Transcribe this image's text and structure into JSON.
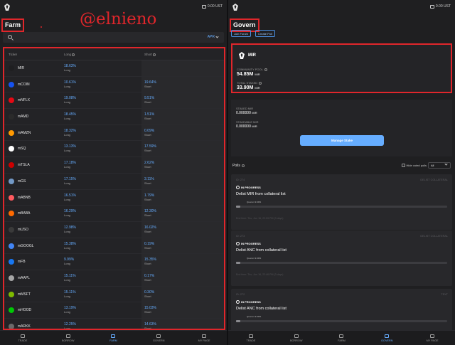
{
  "wallet": {
    "balance": "0.00 UST"
  },
  "watermark": "@elnieno",
  "farm": {
    "title": "Farm",
    "sort_select": "APR",
    "columns": {
      "ticker": "Ticker",
      "long": "Long",
      "short": "Short"
    },
    "rows": [
      {
        "ticker": "MIR",
        "long_apr": "18.63%",
        "long_action": "Long",
        "short_apr": "",
        "short_action": "",
        "icon_color": "#1f1f21",
        "icon": "mir-icon"
      },
      {
        "ticker": "mCOIN",
        "long_apr": "10.61%",
        "long_action": "Long",
        "short_apr": "19.64%",
        "short_action": "Short",
        "icon_color": "#1652f0",
        "icon": "coinbase-icon"
      },
      {
        "ticker": "mNFLX",
        "long_apr": "19.08%",
        "long_action": "Long",
        "short_apr": "9.51%",
        "short_action": "Short",
        "icon_color": "#e50914",
        "icon": "netflix-icon"
      },
      {
        "ticker": "mAMD",
        "long_apr": "18.45%",
        "long_action": "Long",
        "short_apr": "1.51%",
        "short_action": "Short",
        "icon_color": "#2a2a2a",
        "icon": "amd-icon"
      },
      {
        "ticker": "mAMZN",
        "long_apr": "18.32%",
        "long_action": "Long",
        "short_apr": "0.09%",
        "short_action": "Short",
        "icon_color": "#ff9900",
        "icon": "amazon-icon"
      },
      {
        "ticker": "mSQ",
        "long_apr": "13.13%",
        "long_action": "Long",
        "short_apr": "17.59%",
        "short_action": "Short",
        "icon_color": "#ffffff",
        "icon": "square-icon"
      },
      {
        "ticker": "mTSLA",
        "long_apr": "17.18%",
        "long_action": "Long",
        "short_apr": "2.62%",
        "short_action": "Short",
        "icon_color": "#cc0000",
        "icon": "tesla-icon"
      },
      {
        "ticker": "mGS",
        "long_apr": "17.15%",
        "long_action": "Long",
        "short_apr": "3.11%",
        "short_action": "Short",
        "icon_color": "#7399c6",
        "icon": "goldman-icon"
      },
      {
        "ticker": "mABNB",
        "long_apr": "16.51%",
        "long_action": "Long",
        "short_apr": "1.79%",
        "short_action": "Short",
        "icon_color": "#ff5a5f",
        "icon": "airbnb-icon"
      },
      {
        "ticker": "mBABA",
        "long_apr": "16.29%",
        "long_action": "Long",
        "short_apr": "12.30%",
        "short_action": "Short",
        "icon_color": "#ff6a00",
        "icon": "alibaba-icon"
      },
      {
        "ticker": "mUSO",
        "long_apr": "12.98%",
        "long_action": "Long",
        "short_apr": "16.02%",
        "short_action": "Short",
        "icon_color": "#3a3a3a",
        "icon": "uso-icon"
      },
      {
        "ticker": "mGOOGL",
        "long_apr": "15.38%",
        "long_action": "Long",
        "short_apr": "0.19%",
        "short_action": "Short",
        "icon_color": "#4285f4",
        "icon": "google-icon"
      },
      {
        "ticker": "mFB",
        "long_apr": "9.99%",
        "long_action": "Long",
        "short_apr": "15.35%",
        "short_action": "Short",
        "icon_color": "#1877f2",
        "icon": "facebook-icon"
      },
      {
        "ticker": "mAAPL",
        "long_apr": "15.11%",
        "long_action": "Long",
        "short_apr": "0.17%",
        "short_action": "Short",
        "icon_color": "#a6a6a6",
        "icon": "apple-icon"
      },
      {
        "ticker": "mMSFT",
        "long_apr": "15.11%",
        "long_action": "Long",
        "short_apr": "0.30%",
        "short_action": "Short",
        "icon_color": "#7fba00",
        "icon": "microsoft-icon"
      },
      {
        "ticker": "mHOOD",
        "long_apr": "13.19%",
        "long_action": "Long",
        "short_apr": "15.03%",
        "short_action": "Short",
        "icon_color": "#00c805",
        "icon": "robinhood-icon"
      },
      {
        "ticker": "mARKK",
        "long_apr": "12.25%",
        "long_action": "Long",
        "short_apr": "14.63%",
        "short_action": "Short",
        "icon_color": "#6a6a6a",
        "icon": "ark-icon"
      }
    ]
  },
  "nav": {
    "items": [
      {
        "label": "TRADE",
        "icon": "trade-icon"
      },
      {
        "label": "BORROW",
        "icon": "borrow-icon"
      },
      {
        "label": "FARM",
        "icon": "farm-icon"
      },
      {
        "label": "GOVERN",
        "icon": "govern-icon"
      },
      {
        "label": "MY PAGE",
        "icon": "mypage-icon"
      }
    ],
    "left_active": "FARM",
    "right_active": "GOVERN"
  },
  "govern": {
    "title": "Govern",
    "join_forum": "Join Forum",
    "create_poll": "Create Poll",
    "mir_card": {
      "name": "MIR",
      "community_pool_label": "COMMUNITY POOL",
      "community_pool_value": "54.85M",
      "community_pool_unit": "MIR",
      "total_staked_label": "TOTAL STAKED",
      "total_staked_value": "33.90M",
      "total_staked_unit": "MIR"
    },
    "stake_card": {
      "staked_label": "STAKED MIR",
      "staked_value": "0.000000",
      "staked_unit": "MIR",
      "stakeable_label": "STAKEABLE MIR",
      "stakeable_value": "0.000000",
      "stakeable_unit": "MIR",
      "manage_button": "Manage Stake"
    },
    "polls_title": "Polls",
    "hide_voted": "Hide voted polls",
    "filter_value": "All",
    "polls": [
      {
        "id": "ID: 274",
        "type": "DELIST COLLATERAL",
        "status": "IN PROGRESS",
        "title": "Delist MIR from collateral list",
        "quorum": "Quorum 9.99%",
        "progress": 0.02,
        "end_time": "End time: Thu, Jun 16, 22:59 PM (3 days)"
      },
      {
        "id": "ID: 273",
        "type": "DELIST COLLATERAL",
        "status": "IN PROGRESS",
        "title": "Delist ANC from collateral list",
        "quorum": "Quorum 9.99%",
        "progress": 0.02,
        "end_time": "End time: Thu, Jun 16, 22:46 PM (3 days)"
      },
      {
        "id": "ID: 272",
        "type": "TEXT",
        "status": "IN PROGRESS",
        "title": "Delist ANC from collateral list",
        "quorum": "Quorum 9.99%",
        "progress": 0.02,
        "end_time": ""
      }
    ]
  }
}
